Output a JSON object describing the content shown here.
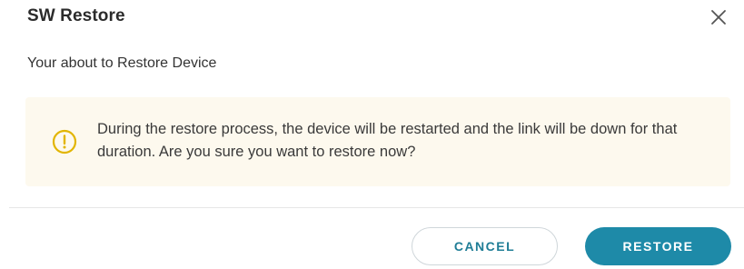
{
  "dialog": {
    "title": "SW Restore",
    "subtitle": "Your about to Restore Device",
    "warning": {
      "icon": "warning-circle-icon",
      "text": "During the restore process, the device will be restarted and the link will be down for that duration. Are you sure you want to restore now?"
    },
    "buttons": {
      "cancel_label": "CANCEL",
      "restore_label": "RESTORE"
    },
    "close_icon": "close-icon"
  },
  "colors": {
    "accent": "#1e8aa8",
    "warning_bg": "#fdf9ee",
    "warning_icon": "#e2b500"
  }
}
